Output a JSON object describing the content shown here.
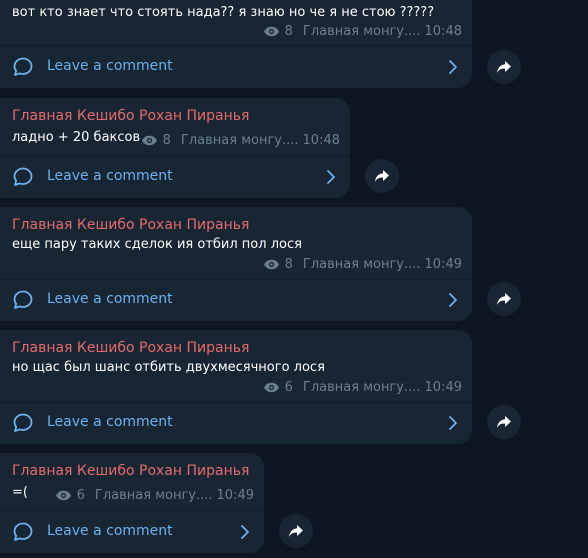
{
  "messages": [
    {
      "text": "вот кто знает что стоять нада?? я знаю но че я не стою ?????",
      "views": "8",
      "channel": "Главная монгу....",
      "time": "10:48",
      "comment_label": "Leave a comment"
    },
    {
      "author": "Главная Кешибо Рохан Пиранья",
      "text": "ладно + 20 баксов",
      "views": "8",
      "channel": "Главная монгу....",
      "time": "10:48",
      "comment_label": "Leave a comment"
    },
    {
      "author": "Главная Кешибо Рохан Пиранья",
      "text": "еще пару таких сделок ия отбил пол лося",
      "views": "8",
      "channel": "Главная монгу....",
      "time": "10:49",
      "comment_label": "Leave a comment"
    },
    {
      "author": "Главная Кешибо Рохан Пиранья",
      "text": "но щас был шанс отбить двухмесячного лося",
      "views": "6",
      "channel": "Главная монгу....",
      "time": "10:49",
      "comment_label": "Leave a comment"
    },
    {
      "author": "Главная Кешибо Рохан Пиранья",
      "text": "=(",
      "views": "6",
      "channel": "Главная монгу....",
      "time": "10:49",
      "comment_label": "Leave a comment"
    }
  ],
  "colors": {
    "background": "#0e1621",
    "bubble": "#182533",
    "author": "#e36b6b",
    "link": "#6ab2f2",
    "meta": "#6d7f8f"
  },
  "icons": [
    "eye-icon",
    "comment-icon",
    "chevron-right-icon",
    "share-icon"
  ]
}
